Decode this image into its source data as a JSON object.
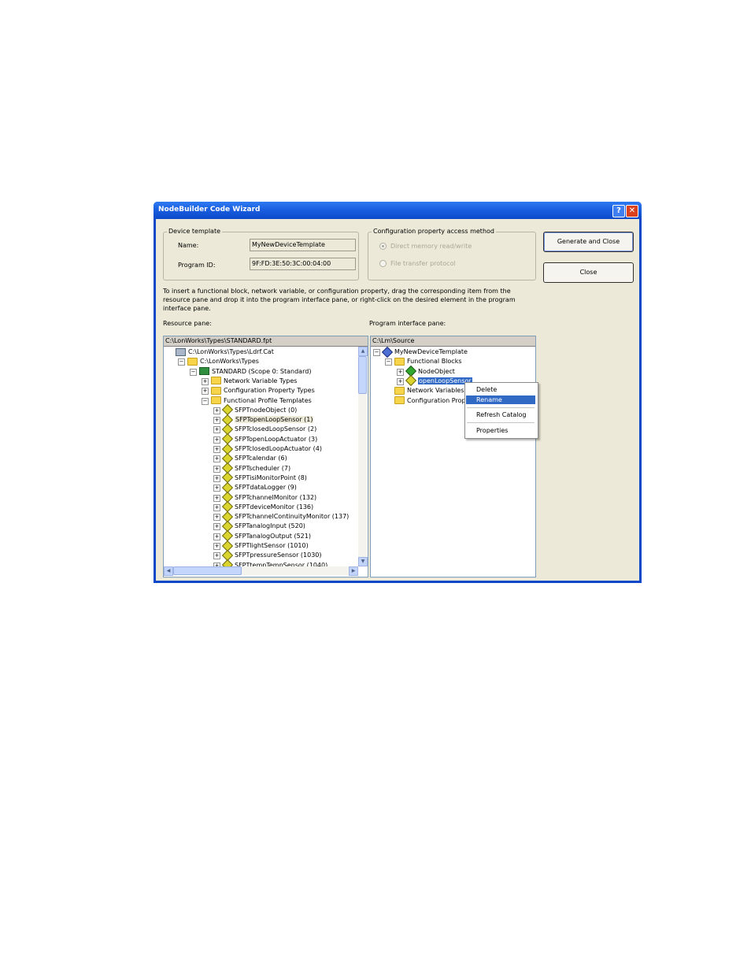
{
  "window": {
    "title": "NodeBuilder Code Wizard",
    "help_glyph": "?",
    "close_glyph": "✕"
  },
  "device_template": {
    "legend": "Device template",
    "name_label": "Name:",
    "name_value": "MyNewDeviceTemplate",
    "program_id_label": "Program ID:",
    "program_id_value": "9F:FD:3E:50:3C:00:04:00"
  },
  "access_method": {
    "legend": "Configuration property access method",
    "options": [
      {
        "label": "Direct memory read/write",
        "selected": true
      },
      {
        "label": "File transfer protocol",
        "selected": false
      }
    ]
  },
  "buttons": {
    "generate_close": "Generate and Close",
    "close": "Close"
  },
  "instructions": "To insert a functional block, network variable, or configuration property, drag the corresponding item from the resource pane and drop it into the program interface pane, or right-click on the desired element in the program interface pane.",
  "resource_pane": {
    "label": "Resource pane:",
    "path": "C:\\LonWorks\\Types\\STANDARD.fpt",
    "tree": [
      {
        "text": "C:\\LonWorks\\Types\\Ldrf.Cat",
        "icon": "catalog-icon",
        "expander": ""
      },
      {
        "text": "C:\\LonWorks\\Types",
        "icon": "folder-icon",
        "expander": "−"
      },
      {
        "text": "STANDARD (Scope 0: Standard)",
        "icon": "profile-folder-icon",
        "expander": "−"
      },
      {
        "text": "Network Variable Types",
        "icon": "folder-icon",
        "expander": "+"
      },
      {
        "text": "Configuration Property Types",
        "icon": "folder-icon",
        "expander": "+"
      },
      {
        "text": "Functional Profile Templates",
        "icon": "folder-icon",
        "expander": "−"
      },
      {
        "text": "SFPTnodeObject (0)",
        "icon": "functional-block-icon",
        "expander": "+"
      },
      {
        "text": "SFPTopenLoopSensor (1)",
        "icon": "functional-block-icon",
        "expander": "+"
      },
      {
        "text": "SFPTclosedLoopSensor (2)",
        "icon": "functional-block-icon",
        "expander": "+"
      },
      {
        "text": "SFPTopenLoopActuator (3)",
        "icon": "functional-block-icon",
        "expander": "+"
      },
      {
        "text": "SFPTclosedLoopActuator (4)",
        "icon": "functional-block-icon",
        "expander": "+"
      },
      {
        "text": "SFPTcalendar (6)",
        "icon": "functional-block-icon",
        "expander": "+"
      },
      {
        "text": "SFPTscheduler (7)",
        "icon": "functional-block-icon",
        "expander": "+"
      },
      {
        "text": "SFPTisiMonitorPoint (8)",
        "icon": "functional-block-icon",
        "expander": "+"
      },
      {
        "text": "SFPTdataLogger (9)",
        "icon": "functional-block-icon",
        "expander": "+"
      },
      {
        "text": "SFPTchannelMonitor (132)",
        "icon": "functional-block-icon",
        "expander": "+"
      },
      {
        "text": "SFPTdeviceMonitor (136)",
        "icon": "functional-block-icon",
        "expander": "+"
      },
      {
        "text": "SFPTchannelContinuityMonitor (137)",
        "icon": "functional-block-icon",
        "expander": "+"
      },
      {
        "text": "SFPTanalogInput (520)",
        "icon": "functional-block-icon",
        "expander": "+"
      },
      {
        "text": "SFPTanalogOutput (521)",
        "icon": "functional-block-icon",
        "expander": "+"
      },
      {
        "text": "SFPTlightSensor (1010)",
        "icon": "functional-block-icon",
        "expander": "+"
      },
      {
        "text": "SFPTpressureSensor (1030)",
        "icon": "functional-block-icon",
        "expander": "+"
      },
      {
        "text": "SFPTtempTempSensor (1040)",
        "icon": "functional-block-icon",
        "expander": "+"
      }
    ]
  },
  "program_pane": {
    "label": "Program interface pane:",
    "path": "C:\\Lm\\Source",
    "tree": [
      {
        "text": "MyNewDeviceTemplate",
        "icon": "device-icon",
        "expander": "−"
      },
      {
        "text": "Functional Blocks",
        "icon": "folder-icon",
        "expander": "−"
      },
      {
        "text": "NodeObject",
        "icon": "functional-block-icon",
        "expander": "+"
      },
      {
        "text": "openLoopSensor",
        "icon": "functional-block-icon",
        "expander": "+"
      },
      {
        "text": "Network Variables",
        "icon": "folder-icon",
        "expander": ""
      },
      {
        "text": "Configuration Prope",
        "icon": "folder-icon",
        "expander": ""
      }
    ]
  },
  "context_menu": {
    "items": [
      "Delete",
      "Rename",
      "Refresh Catalog",
      "Properties"
    ],
    "highlighted": "Rename"
  },
  "scroll_glyphs": {
    "up": "▲",
    "down": "▼",
    "left": "◀",
    "right": "▶"
  }
}
